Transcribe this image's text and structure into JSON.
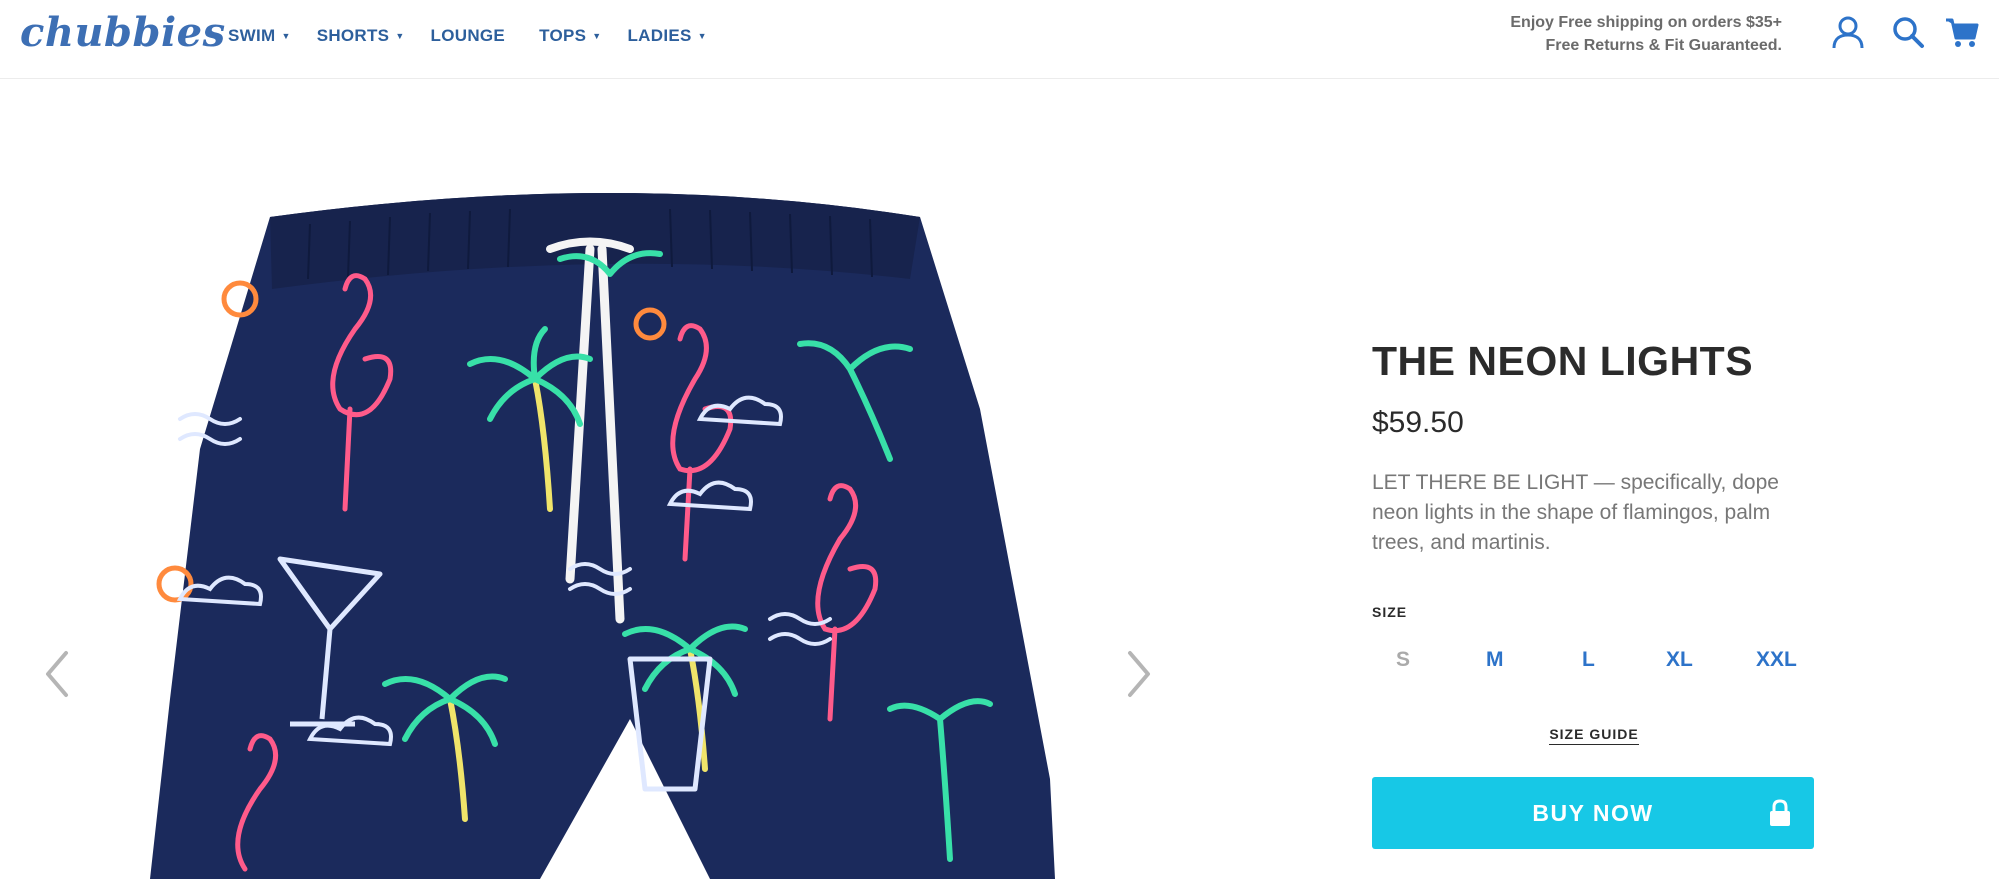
{
  "brand": {
    "logo_text": "chubbies",
    "color": "#3d6fb4"
  },
  "nav": [
    {
      "label": "SWIM",
      "has_dropdown": true
    },
    {
      "label": "SHORTS",
      "has_dropdown": true
    },
    {
      "label": "LOUNGE",
      "has_dropdown": false
    },
    {
      "label": "TOPS",
      "has_dropdown": true
    },
    {
      "label": "LADIES",
      "has_dropdown": true
    }
  ],
  "promo": {
    "line1": "Enjoy Free shipping on orders $35+",
    "line2": "Free Returns & Fit Guaranteed."
  },
  "header_icons": [
    "account-icon",
    "search-icon",
    "cart-icon"
  ],
  "product": {
    "title": "THE NEON LIGHTS",
    "price": "$59.50",
    "description": "LET THERE BE LIGHT — specifically, dope neon lights in the shape of flamingos, palm trees, and martinis.",
    "size_label": "SIZE",
    "sizes": [
      {
        "label": "S",
        "available": false
      },
      {
        "label": "M",
        "available": true
      },
      {
        "label": "L",
        "available": true
      },
      {
        "label": "XL",
        "available": true
      },
      {
        "label": "XXL",
        "available": true
      }
    ],
    "size_guide_label": "SIZE GUIDE",
    "buy_label": "BUY NOW"
  },
  "colors": {
    "accent_blue": "#2d73c9",
    "buy_button": "#17c8e6",
    "shorts_navy": "#1b2a5c"
  }
}
